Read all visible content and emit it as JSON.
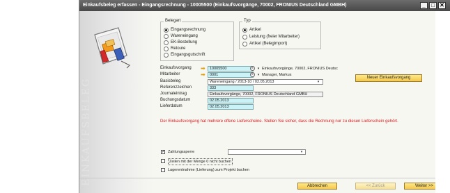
{
  "window": {
    "title": "Einkaufsbeleg erfassen - Eingangsrechnung - 10005500 (Einkaufsvorgänge, 70002, FRONIUS Deutschland GMBH)",
    "controls": [
      "_",
      "□",
      "✕"
    ]
  },
  "sidebar": {
    "watermark": "EINKAUFSBELEG",
    "icon": "wizard-document-icon"
  },
  "belegart": {
    "legend": "Belegart",
    "options": [
      {
        "label": "Eingangsrechnung",
        "checked": true
      },
      {
        "label": "Wareneingang",
        "checked": false
      },
      {
        "label": "EK-Bestellung",
        "checked": false
      },
      {
        "label": "Retoure",
        "checked": false
      },
      {
        "label": "Eingangsgutschrift",
        "checked": false
      }
    ]
  },
  "typ": {
    "legend": "Typ",
    "options": [
      {
        "label": "Artikel",
        "checked": true
      },
      {
        "label": "Leistung (freier Mitarbeiter)",
        "checked": false
      },
      {
        "label": "Artikel (Belegimport)",
        "checked": false
      }
    ]
  },
  "form": {
    "einkaufsvorgang": {
      "label": "Einkaufsvorgang",
      "value": "10005500",
      "description": "Einkaufsvorgänge, 70002, FRONIUS Deutsc"
    },
    "mitarbeiter": {
      "label": "Mitarbeiter",
      "value": "0001",
      "description": "Manager, Markus"
    },
    "basisbeleg": {
      "label": "Basisbeleg",
      "value": "Wareneingang / 2013-10 / 02.05.2013"
    },
    "referenzzeichen": {
      "label": "Referenzzeichen",
      "value": "333"
    },
    "journaleintrag": {
      "label": "Journaleintrag",
      "value": "Einkaufsvorgänge, 70002, FRONIUS Deutschland GMBH"
    },
    "buchungsdatum": {
      "label": "Buchungsdatum",
      "value": "02.05.2013"
    },
    "lieferdatum": {
      "label": "Lieferdatum",
      "value": "02.05.2013"
    }
  },
  "new_purchase_button": "Neuer Einkaufsvorgang",
  "warning": "Der Einkaufsvorgang hat mehrere offene Lieferscheine. Stellen Sie sicher, dass die Rechnung nur zu diesen Lieferschein gehört.",
  "options": {
    "zahlungssperre": {
      "label": "Zahlungssperre",
      "checked": true,
      "value": ""
    },
    "zeilen_menge_null": {
      "label": "Zeilen mit der Menge 0 nicht buchen",
      "checked": false
    },
    "lagerentnahme": {
      "label": "Lagerentnahme (Lieferung) zum Projekt buchen",
      "checked": false
    }
  },
  "footer": {
    "cancel": "Abbrechen",
    "back": "<< Zurück",
    "next": "Weiter >>"
  },
  "colors": {
    "titlebar": "#585858",
    "field_highlight": "#cbf3f7",
    "button": "#f5c84c",
    "warning": "#d21d1d"
  }
}
